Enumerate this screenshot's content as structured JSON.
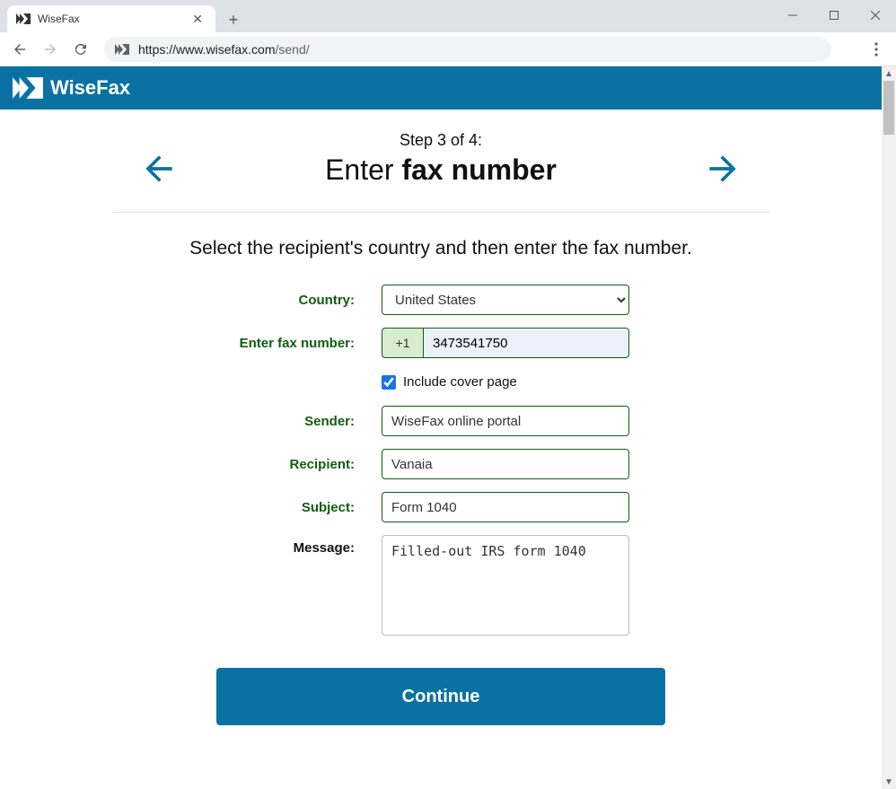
{
  "browser": {
    "tab_title": "WiseFax",
    "url_host": "https://www.wisefax.com",
    "url_path": "/send/"
  },
  "header": {
    "brand": "WiseFax"
  },
  "step": {
    "label": "Step 3 of 4:",
    "title_light": "Enter ",
    "title_bold": "fax number"
  },
  "instruction": "Select the recipient's country and then enter the fax number.",
  "form": {
    "country_label": "Country:",
    "country_value": "United States",
    "fax_label": "Enter fax number:",
    "prefix": "+1",
    "fax_value": "3473541750",
    "cover_label": "Include cover page",
    "cover_checked": true,
    "sender_label": "Sender:",
    "sender_value": "WiseFax online portal",
    "recipient_label": "Recipient:",
    "recipient_value": "Vanaia",
    "subject_label": "Subject:",
    "subject_value": "Form 1040",
    "message_label": "Message:",
    "message_value": "Filled-out IRS form 1040"
  },
  "continue_label": "Continue"
}
